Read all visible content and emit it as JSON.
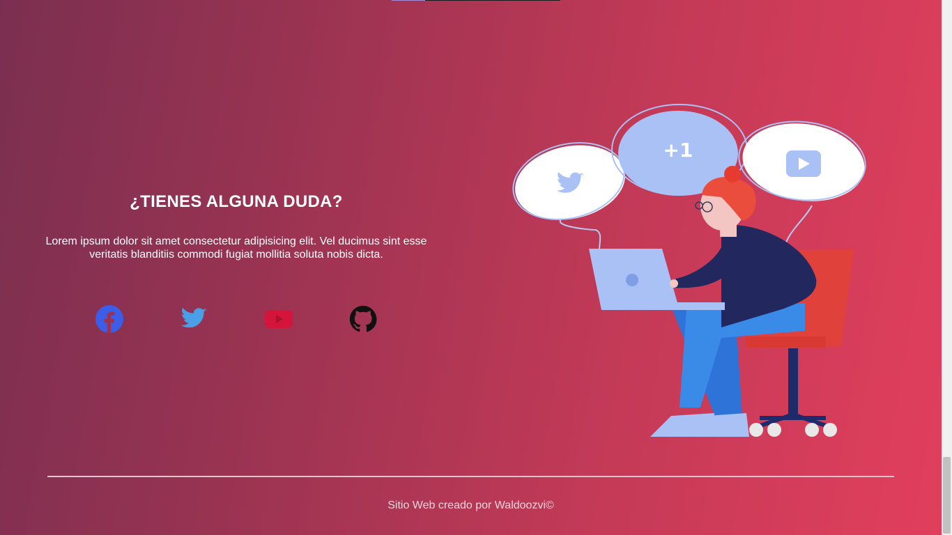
{
  "contact": {
    "heading": "¿TIENES ALGUNA DUDA?",
    "body": "Lorem ipsum dolor sit amet consectetur adipisicing elit. Vel ducimus sint esse veritatis blanditiis commodi fugiat mollitia soluta nobis dicta."
  },
  "social_links": [
    {
      "name": "facebook-icon",
      "color": "#3b5de7"
    },
    {
      "name": "twitter-icon",
      "color": "#4a9fe6"
    },
    {
      "name": "youtube-icon",
      "color": "#d4143a"
    },
    {
      "name": "github-icon",
      "color": "#111111"
    }
  ],
  "illustration": {
    "bubble_plus_text": "+1"
  },
  "footer": {
    "credit": "Sitio Web creado por Waldoozvi©"
  }
}
